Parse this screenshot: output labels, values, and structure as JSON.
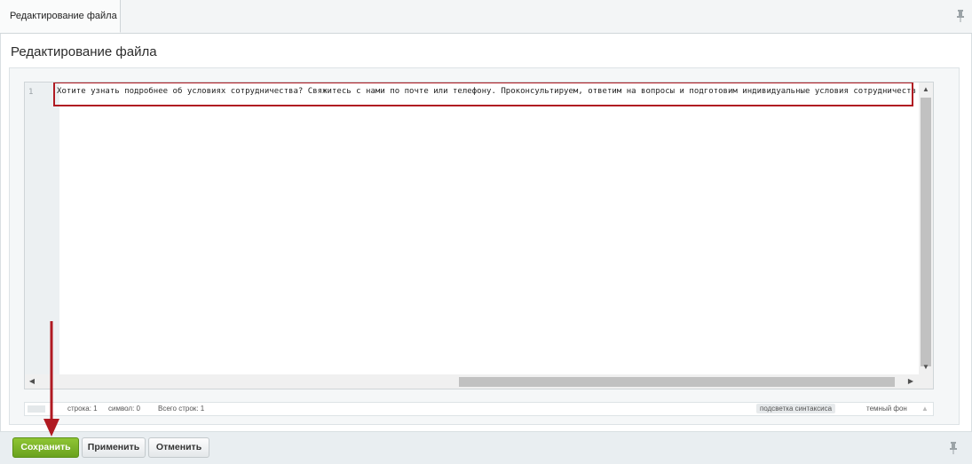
{
  "tab": {
    "label": "Редактирование файла"
  },
  "page": {
    "title": "Редактирование файла"
  },
  "editor": {
    "line_number": "1",
    "content": "Хотите узнать подробнее об условиях сотрудничества? Свяжитесь с нами по почте или телефону. Проконсультируем, ответим на вопросы и подготовим индивидуальные условия сотрудничества.",
    "highlight_color": "#b01a22"
  },
  "status": {
    "line": "строка: 1",
    "symbol": "символ: 0",
    "total": "Всего строк: 1",
    "syntax": "подсветка синтаксиса",
    "theme": "темный фон"
  },
  "buttons": {
    "save": "Сохранить",
    "apply": "Применить",
    "cancel": "Отменить"
  },
  "icons": {
    "pin": "pin-icon",
    "scroll_up": "up-arrow-icon",
    "scroll_down": "down-arrow-icon",
    "scroll_left": "left-arrow-icon",
    "scroll_right": "right-arrow-icon",
    "annotation_arrow": "red-arrow-icon"
  },
  "colors": {
    "save_button": "#78b124",
    "annotation": "#b01a22"
  }
}
